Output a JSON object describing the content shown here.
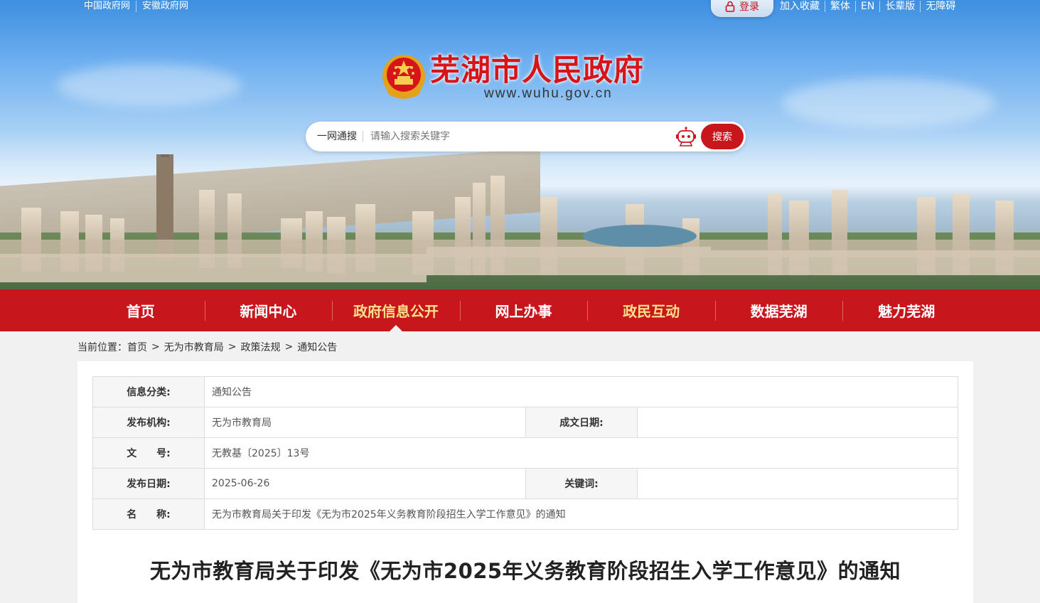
{
  "topbar": {
    "left_links": [
      "中国政府网",
      "安徽政府网"
    ],
    "login_label": "登录",
    "right_links": [
      "加入收藏",
      "繁体",
      "EN",
      "长辈版",
      "无障碍"
    ]
  },
  "header": {
    "site_title": "芜湖市人民政府",
    "site_url": "www.wuhu.gov.cn"
  },
  "search": {
    "scope_label": "一网通搜",
    "placeholder": "请输入搜索关键字",
    "button_label": "搜索"
  },
  "nav": {
    "items": [
      {
        "label": "首页"
      },
      {
        "label": "新闻中心"
      },
      {
        "label": "政府信息公开"
      },
      {
        "label": "网上办事"
      },
      {
        "label": "政民互动"
      },
      {
        "label": "数据芜湖"
      },
      {
        "label": "魅力芜湖"
      }
    ]
  },
  "breadcrumb": {
    "prefix": "当前位置：",
    "items": [
      "首页",
      "无为市教育局",
      "政策法规",
      "通知公告"
    ],
    "separator": ">"
  },
  "meta": {
    "category_label": "信息分类:",
    "category_value": "通知公告",
    "publisher_label": "发布机构:",
    "publisher_value": "无为市教育局",
    "written_date_label": "成文日期:",
    "written_date_value": "",
    "doc_no_label": "文　　号:",
    "doc_no_value": "无教基〔2025〕13号",
    "publish_date_label": "发布日期:",
    "publish_date_value": "2025-06-26",
    "keywords_label": "关键词:",
    "keywords_value": "",
    "name_label": "名　　称:",
    "name_value": "无为市教育局关于印发《无为市2025年义务教育阶段招生入学工作意见》的通知"
  },
  "article": {
    "title": "无为市教育局关于印发《无为市2025年义务教育阶段招生入学工作意见》的通知"
  },
  "colors": {
    "brand_red": "#c8161d",
    "nav_highlight": "#ffe08a"
  }
}
